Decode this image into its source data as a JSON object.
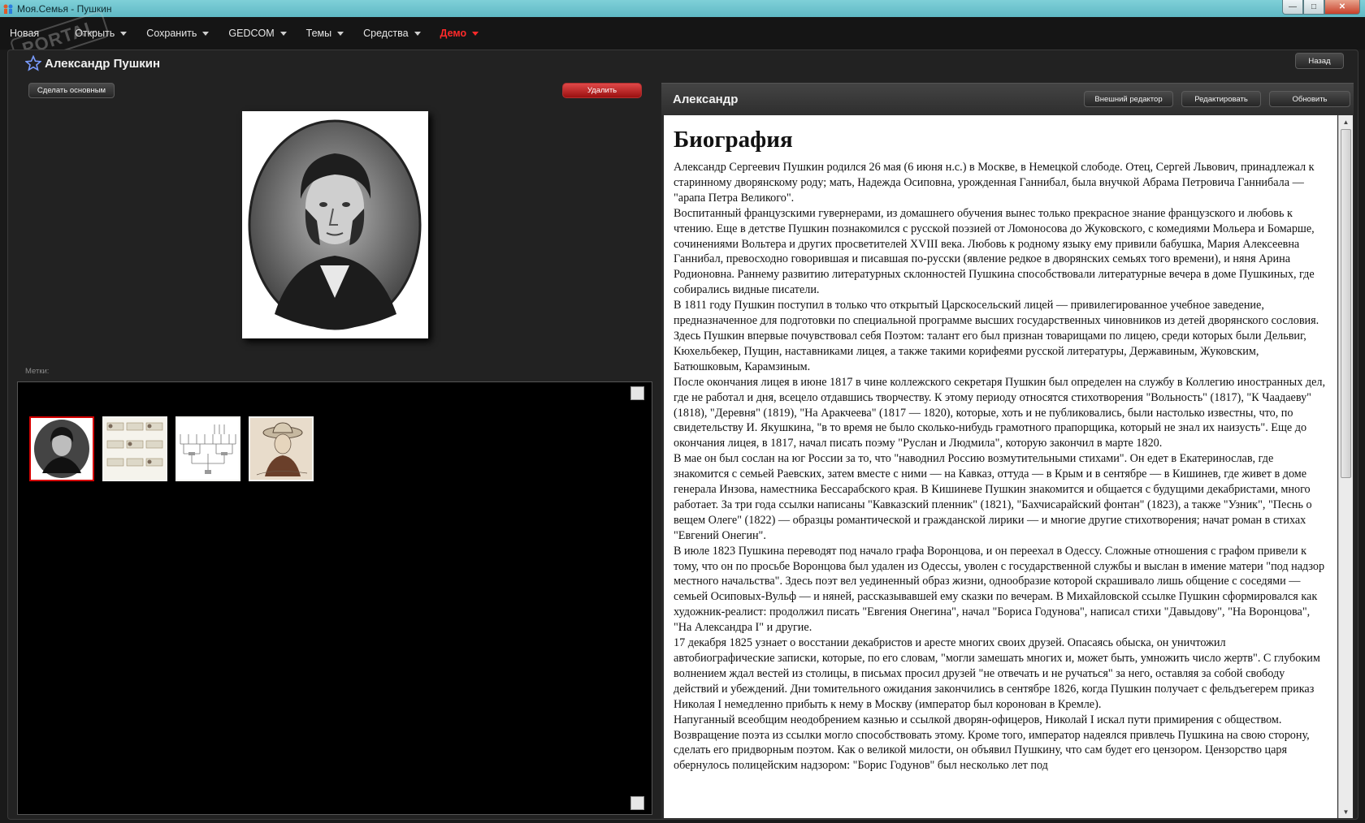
{
  "window": {
    "title": "Моя.Семья - Пушкин",
    "controls": [
      "minimize-icon",
      "maximize-icon",
      "close-icon"
    ]
  },
  "menu": [
    {
      "label": "Новая",
      "has_dropdown": false
    },
    {
      "label": "Открыть",
      "has_dropdown": true
    },
    {
      "label": "Сохранить",
      "has_dropdown": true
    },
    {
      "label": "GEDCOM",
      "has_dropdown": true
    },
    {
      "label": "Темы",
      "has_dropdown": true
    },
    {
      "label": "Средства",
      "has_dropdown": true
    },
    {
      "label": "Демо",
      "has_dropdown": true,
      "accent": "#ff2a2a"
    }
  ],
  "watermark": "PORTAL",
  "person": {
    "name": "Александр Пушкин",
    "back_label": "Назад",
    "make_main_label": "Сделать основным",
    "delete_label": "Удалить",
    "tags_label": "Метки:"
  },
  "gallery": {
    "thumbnails": [
      {
        "kind": "portrait",
        "selected": true
      },
      {
        "kind": "family-tree-chart",
        "selected": false
      },
      {
        "kind": "pedigree-chart",
        "selected": false
      },
      {
        "kind": "sketch-portrait",
        "selected": false
      }
    ]
  },
  "detail": {
    "title": "Александр",
    "external_editor_label": "Внешний редактор",
    "edit_label": "Редактировать",
    "refresh_label": "Обновить",
    "heading": "Биография",
    "paragraphs": [
      "Александр Сергеевич Пушкин родился 26 мая (6 июня н.с.) в Москве, в Немецкой слободе. Отец, Сергей Львович, принадлежал к старинному дворянскому роду; мать, Надежда Осиповна, урожденная Ганнибал, была внучкой Абрама Петровича Ганнибала — \"арапа Петра Великого\".",
      "Воспитанный французскими гувернерами, из домашнего обучения вынес только прекрасное знание французского и любовь к чтению. Еще в детстве Пушкин познакомился с русской поэзией от Ломоносова до Жуковского, с комедиями Мольера и Бомарше, сочинениями Вольтера и других просветителей XVIII века. Любовь к родному языку ему привили бабушка, Мария Алексеевна Ганнибал, превосходно говорившая и писавшая по-русски (явление редкое в дворянских семьях того времени), и няня Арина Родионовна. Раннему развитию литературных склонностей Пушкина способствовали литературные вечера в доме Пушкиных, где собирались видные писатели.",
      "В 1811 году Пушкин поступил в только что открытый Царскосельский лицей — привилегированное учебное заведение, предназначенное для подготовки по специальной программе высших государственных чиновников из детей дворянского сословия. Здесь Пушкин впервые почувствовал себя Поэтом: талант его был признан товарищами по лицею, среди которых были Дельвиг, Кюхельбекер, Пущин, наставниками лицея, а также такими корифеями русской литературы, Державиным, Жуковским, Батюшковым, Карамзиным.",
      "После окончания лицея в июне 1817 в чине коллежского секретаря Пушкин был определен на службу в Коллегию иностранных дел, где не работал и дня, всецело отдавшись творчеству. К этому периоду относятся стихотворения \"Вольность\" (1817), \"К Чаадаеву\" (1818), \"Деревня\" (1819), \"На Аракчеева\" (1817 — 1820), которые, хоть и не публиковались, были настолько известны, что, по свидетельству И. Якушкина, \"в то время не было сколько-нибудь грамотного прапорщика, который не знал их наизусть\". Еще до окончания лицея, в 1817, начал писать поэму \"Руслан и Людмила\", которую закончил в марте 1820.",
      "В мае он был сослан на юг России за то, что \"наводнил Россию возмутительными стихами\". Он едет в Екатеринослав, где знакомится с семьей Раевских, затем вместе с ними — на Кавказ, оттуда — в Крым и в сентябре — в Кишинев, где живет в доме генерала Инзова, наместника Бессарабского края. В Кишиневе Пушкин знакомится и общается с будущими декабристами, много работает. За три года ссылки написаны \"Кавказский пленник\" (1821), \"Бахчисарайский фонтан\" (1823), а также \"Узник\", \"Песнь о вещем Олеге\" (1822) — образцы романтической и гражданской лирики — и многие другие стихотворения; начат роман в стихах \"Евгений Онегин\".",
      "В июле 1823 Пушкина переводят под начало графа Воронцова, и он переехал в Одессу. Сложные отношения с графом привели к тому, что он по просьбе Воронцова был удален из Одессы, уволен с государственной службы и выслан в имение матери \"под надзор местного начальства\". Здесь поэт вел уединенный образ жизни, однообразие которой скрашивало лишь общение с соседями — семьей Осиповых-Вульф — и няней, рассказывавшей ему сказки по вечерам. В Михайловской ссылке Пушкин сформировался как художник-реалист: продолжил писать \"Евгения Онегина\", начал \"Бориса Годунова\", написал стихи \"Давыдову\", \"На Воронцова\", \"На Александра I\" и другие.",
      "17 декабря 1825 узнает о восстании декабристов и аресте многих своих друзей. Опасаясь обыска, он уничтожил автобиографические записки, которые, по его словам, \"могли замешать многих и, может быть, умножить число жертв\". С глубоким волнением ждал вестей из столицы, в письмах просил друзей \"не отвечать и не ручаться\" за него, оставляя за собой свободу действий и убеждений. Дни томительного ожидания закончились в сентябре 1826, когда Пушкин получает с фельдъегерем приказ Николая I немедленно прибыть к нему в Москву (император был коронован в Кремле).",
      "Напуганный всеобщим неодобрением казнью и ссылкой дворян-офицеров, Николай I искал пути примирения с обществом. Возвращение поэта из ссылки могло способствовать этому. Кроме того, император надеялся привлечь Пушкина на свою сторону, сделать его придворным поэтом. Как о великой милости, он объявил Пушкину, что сам будет его цензором. Цензорство царя обернулось полицейским надзором: \"Борис Годунов\" был несколько лет под"
    ]
  },
  "colors": {
    "menu_bg": "#151515",
    "panel_bg": "#222222",
    "accent_red": "#ff2a2a",
    "delete_red": "#c02020",
    "title_bar": "#6cc4ce"
  }
}
